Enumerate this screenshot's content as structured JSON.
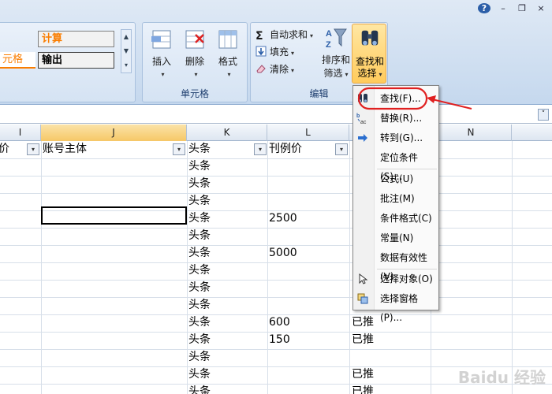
{
  "window_controls": {
    "help": "?",
    "minimize": "–",
    "restore": "❐",
    "close": "×"
  },
  "styles_group": {
    "calc_label": "计算",
    "cell_label": "元格",
    "output_label": "输出"
  },
  "cells_group": {
    "label": "单元格",
    "insert": "插入",
    "delete": "删除",
    "format": "格式"
  },
  "edit_group": {
    "label": "编辑",
    "autosum": "自动求和",
    "fill": "填充",
    "clear": "清除",
    "sort_filter_l1": "排序和",
    "sort_filter_l2": "筛选",
    "find_select_l1": "查找和",
    "find_select_l2": "选择"
  },
  "formula_bar": {
    "expand": "˅"
  },
  "columns": [
    {
      "id": "I",
      "label": "I"
    },
    {
      "id": "J",
      "label": "J"
    },
    {
      "id": "K",
      "label": "K"
    },
    {
      "id": "L",
      "label": "L"
    },
    {
      "id": "N",
      "label": "N"
    }
  ],
  "headers": {
    "col_i": "价",
    "col_j": "账号主体",
    "col_k": "头条",
    "col_l": "刊例价"
  },
  "rows": [
    {
      "k": "头条",
      "l": "",
      "m": ""
    },
    {
      "k": "头条",
      "l": "",
      "m": ""
    },
    {
      "k": "头条",
      "l": "",
      "m": ""
    },
    {
      "k": "头条",
      "l": "2500",
      "m": ""
    },
    {
      "k": "头条",
      "l": "",
      "m": ""
    },
    {
      "k": "头条",
      "l": "5000",
      "m": ""
    },
    {
      "k": "头条",
      "l": "",
      "m": ""
    },
    {
      "k": "头条",
      "l": "",
      "m": ""
    },
    {
      "k": "头条",
      "l": "",
      "m": ""
    },
    {
      "k": "头条",
      "l": "600",
      "m": "已推"
    },
    {
      "k": "头条",
      "l": "150",
      "m": "已推"
    },
    {
      "k": "头条",
      "l": "",
      "m": ""
    },
    {
      "k": "头条",
      "l": "",
      "m": "已推"
    },
    {
      "k": "头条",
      "l": "",
      "m": "已推"
    }
  ],
  "menu": {
    "find": "查找(F)...",
    "replace": "替换(R)...",
    "goto": "转到(G)...",
    "goto_special": "定位条件(S)...",
    "formulas": "公式(U)",
    "comments": "批注(M)",
    "conditional_format": "条件格式(C)",
    "constants": "常量(N)",
    "data_validation": "数据有效性(V)",
    "select_objects": "选择对象(O)",
    "selection_pane": "选择窗格(P)..."
  },
  "watermark": "Baidu 经验",
  "colors": {
    "accent": "#e8a84a",
    "annotation": "#e02020",
    "ribbon": "#d5e3f3"
  }
}
